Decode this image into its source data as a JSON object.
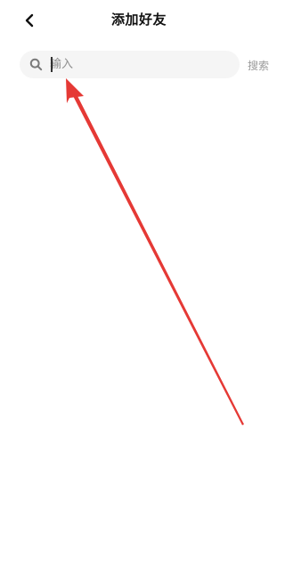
{
  "header": {
    "title": "添加好友",
    "back_icon": "chevron-left-icon"
  },
  "search": {
    "placeholder": "输入",
    "value": "",
    "icon": "search-icon",
    "button_label": "搜索"
  },
  "annotation": {
    "type": "arrow",
    "color": "#e53935",
    "points_to": "search-input"
  }
}
